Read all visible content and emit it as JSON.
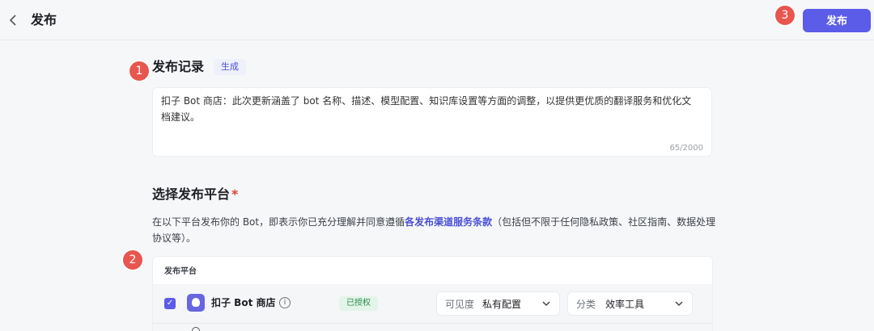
{
  "header": {
    "back_icon": "chevron-left-icon",
    "title": "发布",
    "publish_label": "发布"
  },
  "badges": [
    "1",
    "2",
    "3"
  ],
  "release_notes": {
    "title": "发布记录",
    "generate_label": "生成",
    "text": "扣子 Bot 商店：此次更新涵盖了 bot 名称、描述、模型配置、知识库设置等方面的调整，以提供更优质的翻译服务和优化文档建议。",
    "counter": "65/2000"
  },
  "platforms": {
    "title": "选择发布平台",
    "required_mark": "*",
    "desc_before": "在以下平台发布你的 Bot，即表示你已充分理解并同意遵循",
    "desc_link": "各发布渠道服务条款",
    "desc_after": "（包括但不限于任何隐私政策、社区指南、数据处理协议等）。",
    "table_header": "发布平台",
    "rows": [
      {
        "name": "扣子 Bot 商店",
        "checked": true,
        "status": "已授权",
        "visibility_label": "可见度",
        "visibility_value": "私有配置",
        "category_label": "分类",
        "category_value": "效率工具"
      }
    ]
  },
  "colors": {
    "accent": "#5b5ce8",
    "badge": "#e8564f",
    "authorized_bg": "#e3f5e9",
    "authorized_text": "#2b8a4c"
  }
}
